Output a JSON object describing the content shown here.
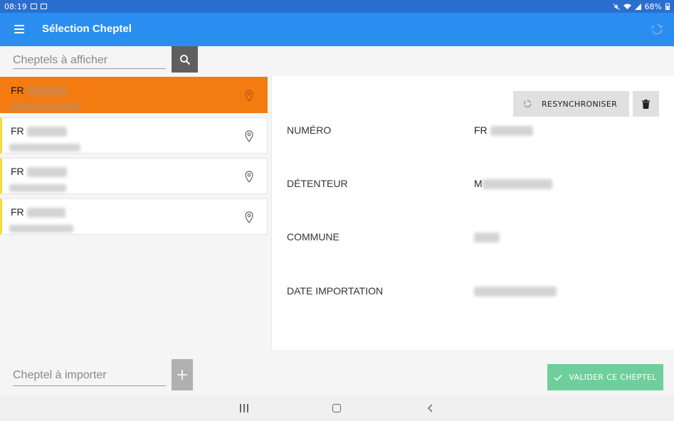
{
  "status": {
    "time": "08:19",
    "battery": "68%"
  },
  "appbar": {
    "title": "Sélection Cheptel"
  },
  "search": {
    "placeholder": "Cheptels à afficher"
  },
  "list": {
    "items": [
      {
        "code": "FR"
      },
      {
        "code": "FR"
      },
      {
        "code": "FR"
      },
      {
        "code": "FR"
      }
    ]
  },
  "detail": {
    "resync_label": "RESYNCHRONISER",
    "fields": [
      {
        "label": "NUMÉRO",
        "value": "FR"
      },
      {
        "label": "DÉTENTEUR",
        "value": "M"
      },
      {
        "label": "COMMUNE",
        "value": ""
      },
      {
        "label": "DATE IMPORTATION",
        "value": ""
      }
    ]
  },
  "bottom": {
    "import_placeholder": "Cheptel à importer",
    "validate_label": "VALIDER CE CHEPTEL"
  },
  "colors": {
    "appbar": "#2a8ef0",
    "statusbar": "#2a6fcf",
    "selected": "#f47b10",
    "item_accent": "#f3dd3b",
    "validate": "#6fcf9c"
  }
}
